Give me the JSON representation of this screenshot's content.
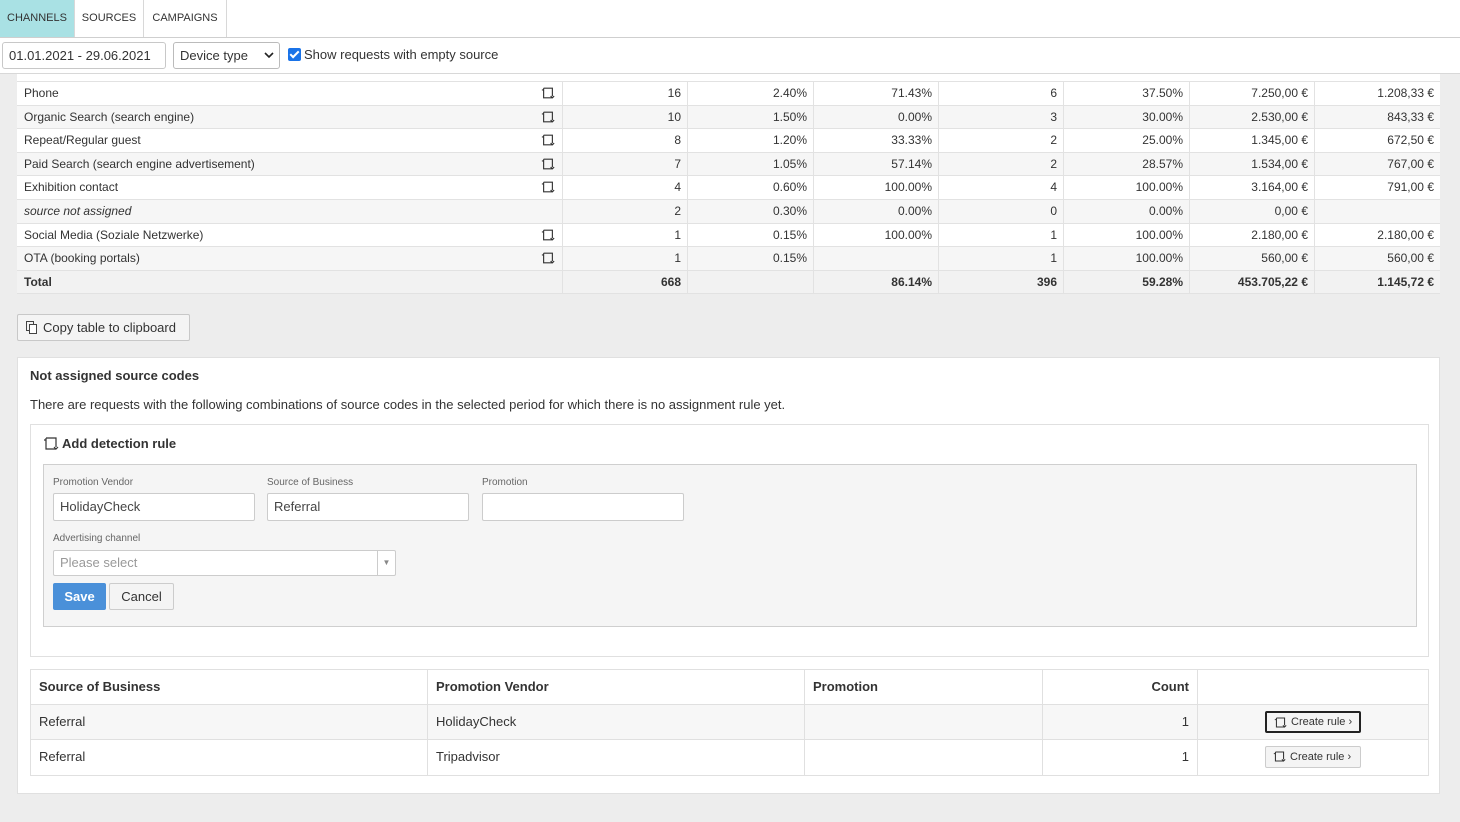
{
  "tabs": [
    {
      "label": "CHANNELS",
      "active": true
    },
    {
      "label": "SOURCES",
      "active": false
    },
    {
      "label": "CAMPAIGNS",
      "active": false
    }
  ],
  "filters": {
    "date_range": "01.01.2021 - 29.06.2021",
    "device_type": "Device type",
    "show_empty_label": "Show requests with empty source",
    "show_empty_checked": true
  },
  "channel_table": {
    "rows": [
      {
        "name": "Phone",
        "icon": "rule-icon",
        "c1": "16",
        "c2": "2.40%",
        "c3": "71.43%",
        "c4": "6",
        "c5": "37.50%",
        "c6": "7.250,00 €",
        "c7": "1.208,33 €"
      },
      {
        "name": "Organic Search (search engine)",
        "icon": "rule-icon",
        "c1": "10",
        "c2": "1.50%",
        "c3": "0.00%",
        "c4": "3",
        "c5": "30.00%",
        "c6": "2.530,00 €",
        "c7": "843,33 €"
      },
      {
        "name": "Repeat/Regular guest",
        "icon": "rule-icon",
        "c1": "8",
        "c2": "1.20%",
        "c3": "33.33%",
        "c4": "2",
        "c5": "25.00%",
        "c6": "1.345,00 €",
        "c7": "672,50 €"
      },
      {
        "name": "Paid Search (search engine advertisement)",
        "icon": "rule-icon",
        "c1": "7",
        "c2": "1.05%",
        "c3": "57.14%",
        "c4": "2",
        "c5": "28.57%",
        "c6": "1.534,00 €",
        "c7": "767,00 €"
      },
      {
        "name": "Exhibition contact",
        "icon": "rule-icon",
        "c1": "4",
        "c2": "0.60%",
        "c3": "100.00%",
        "c4": "4",
        "c5": "100.00%",
        "c6": "3.164,00 €",
        "c7": "791,00 €"
      },
      {
        "name": "source not assigned",
        "icon": "",
        "c1": "2",
        "c2": "0.30%",
        "c3": "0.00%",
        "c4": "0",
        "c5": "0.00%",
        "c6": "0,00 €",
        "c7": ""
      },
      {
        "name": "Social Media (Soziale Netzwerke)",
        "icon": "rule-icon",
        "c1": "1",
        "c2": "0.15%",
        "c3": "100.00%",
        "c4": "1",
        "c5": "100.00%",
        "c6": "2.180,00 €",
        "c7": "2.180,00 €"
      },
      {
        "name": "OTA (booking portals)",
        "icon": "rule-icon",
        "c1": "1",
        "c2": "0.15%",
        "c3": "",
        "c4": "1",
        "c5": "100.00%",
        "c6": "560,00 €",
        "c7": "560,00 €"
      }
    ],
    "total": {
      "name": "Total",
      "c1": "668",
      "c2": "",
      "c3": "86.14%",
      "c4": "396",
      "c5": "59.28%",
      "c6": "453.705,22 €",
      "c7": "1.145,72 €"
    }
  },
  "copy_button": {
    "label": "Copy table to clipboard",
    "icon": "copy-icon"
  },
  "not_assigned": {
    "title": "Not assigned source codes",
    "description": "There are requests with the following combinations of source codes in the selected period for which there is no assignment rule yet.",
    "rule_form": {
      "title": "Add detection rule",
      "promotion_vendor_label": "Promotion Vendor",
      "promotion_vendor_value": "HolidayCheck",
      "source_of_business_label": "Source of Business",
      "source_of_business_value": "Referral",
      "promotion_label": "Promotion",
      "promotion_value": "",
      "advertising_channel_label": "Advertising channel",
      "advertising_channel_placeholder": "Please select",
      "save_label": "Save",
      "cancel_label": "Cancel"
    },
    "table": {
      "headers": [
        "Source of Business",
        "Promotion Vendor",
        "Promotion",
        "Count"
      ],
      "rows": [
        {
          "source": "Referral",
          "vendor": "HolidayCheck",
          "promotion": "",
          "count": "1",
          "button": "Create rule"
        },
        {
          "source": "Referral",
          "vendor": "Tripadvisor",
          "promotion": "",
          "count": "1",
          "button": "Create rule"
        }
      ]
    }
  }
}
